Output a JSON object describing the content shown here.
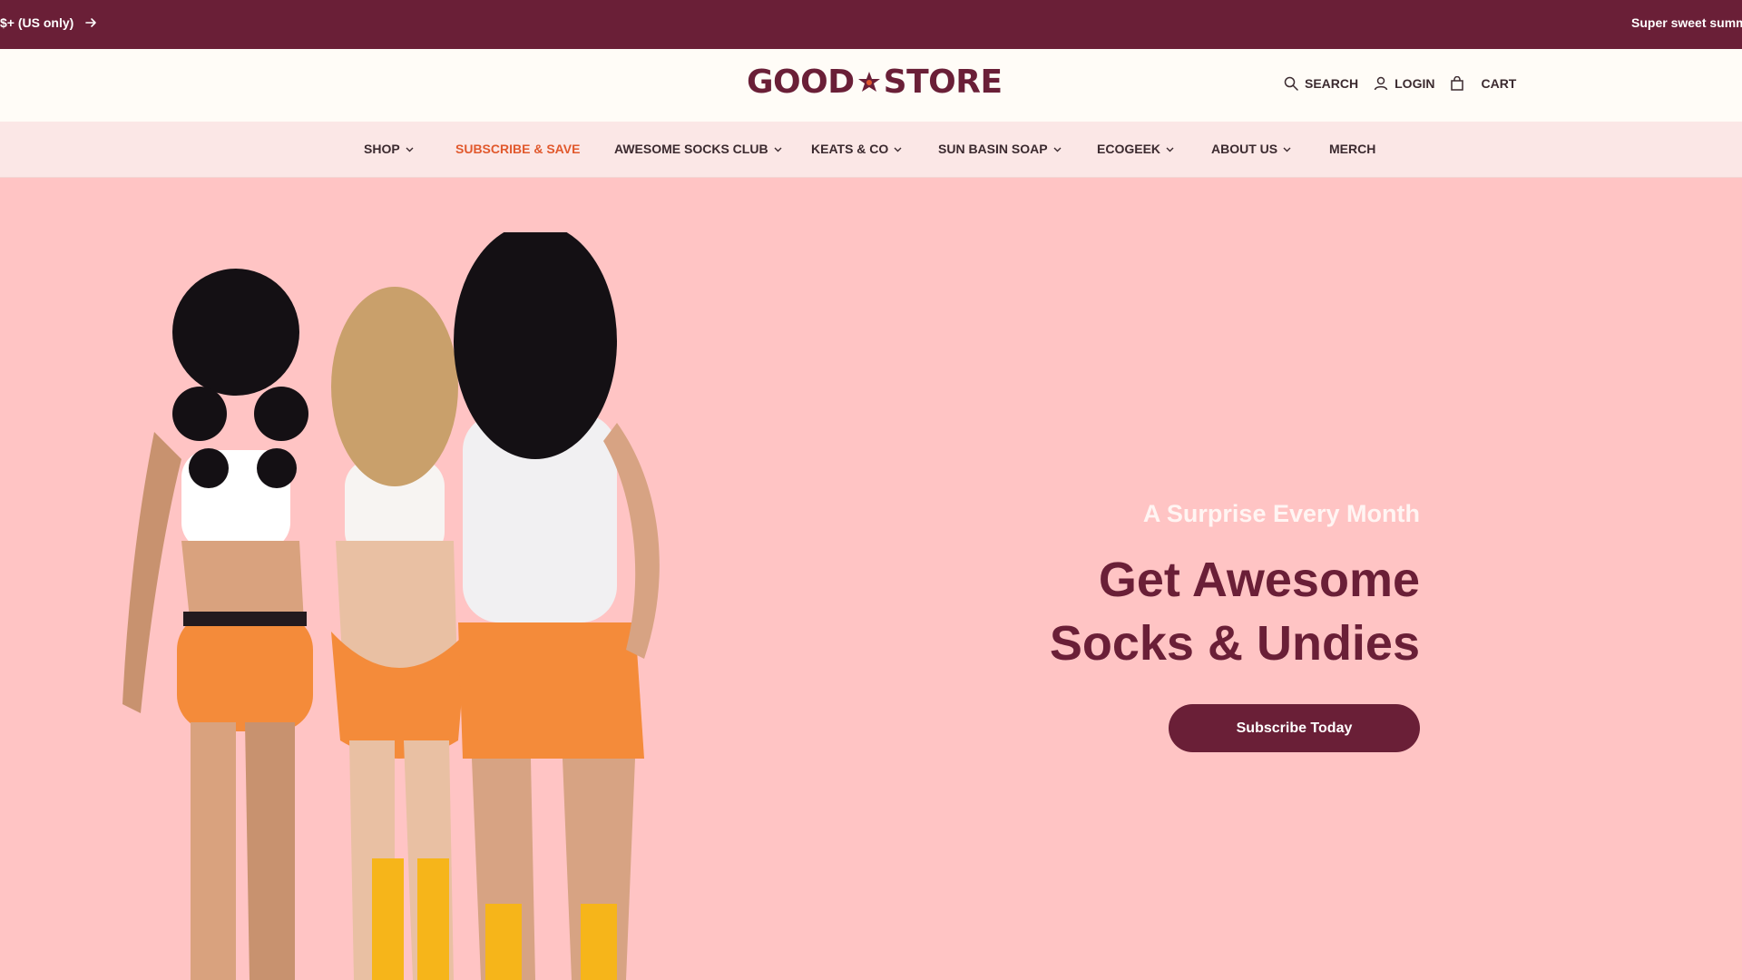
{
  "announcement": {
    "left_text": "$+ (US only)",
    "right_text": "Super sweet summer",
    "arrow_icon": "arrow-right-icon"
  },
  "header": {
    "logo_left": "GOOD",
    "logo_right": "STORE",
    "logo_icon": "star-icon",
    "actions": [
      {
        "label": "SEARCH",
        "icon": "search-icon"
      },
      {
        "label": "LOGIN",
        "icon": "user-icon"
      },
      {
        "label": "CART",
        "icon": "bag-icon"
      }
    ]
  },
  "nav": {
    "items": [
      {
        "label": "SHOP",
        "dropdown": true
      },
      {
        "label": "SUBSCRIBE & SAVE",
        "dropdown": false,
        "accent": true
      },
      {
        "label": "AWESOME SOCKS CLUB",
        "dropdown": true
      },
      {
        "label": "KEATS & CO",
        "dropdown": true
      },
      {
        "label": "SUN BASIN SOAP",
        "dropdown": true
      },
      {
        "label": "ECOGEEK",
        "dropdown": true
      },
      {
        "label": "ABOUT US",
        "dropdown": true
      },
      {
        "label": "MERCH",
        "dropdown": false
      }
    ]
  },
  "hero": {
    "eyebrow": "A Surprise Every Month",
    "title_line1": "Get Awesome",
    "title_line2": "Socks & Undies",
    "cta": "Subscribe Today"
  },
  "colors": {
    "brand": "#6a1f37",
    "accent": "#e1592d",
    "hero_bg": "#ffc4c4",
    "nav_bg": "#fbe7e6",
    "header_bg": "#fffcf7"
  }
}
